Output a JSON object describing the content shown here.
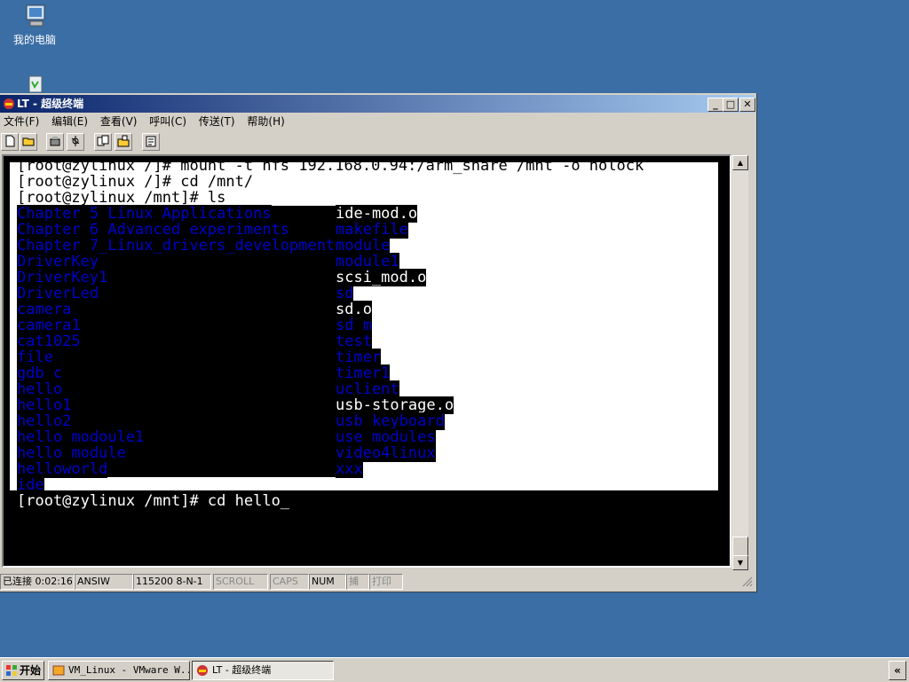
{
  "desktop": {
    "my_computer_label": "我的电脑"
  },
  "window": {
    "title": "LT - 超级终端",
    "menu": [
      "文件(F)",
      "编辑(E)",
      "查看(V)",
      "呼叫(C)",
      "传送(T)",
      "帮助(H)"
    ],
    "buttons": {
      "minimize": "_",
      "maximize": "□",
      "close": "✕"
    }
  },
  "terminal": {
    "lines": [
      "[root@zylinux /]# mount -t nfs 192.168.0.94:/arm_share /mnt -o nolock",
      "[root@zylinux /]# cd /mnt/",
      "[root@zylinux /mnt]# ls"
    ],
    "files_col1": [
      "Chapter_5_Linux_Applications",
      "Chapter_6_Advanced_experiments",
      "Chapter_7_Linux_drivers_development",
      "DriverKey",
      "DriverKey1",
      "DriverLed",
      "camera",
      "camera1",
      "cat1025",
      "file",
      "gdb_c",
      "hello",
      "hello1",
      "hello2",
      "hello_modoule1",
      "hello_module",
      "helloworld",
      "ide"
    ],
    "files_col2": [
      "ide-mod.o",
      "makefile",
      "module",
      "module1",
      "scsi_mod.o",
      "sd",
      "sd.o",
      "sd_m",
      "test",
      "timer",
      "timer1",
      "uclient",
      "usb-storage.o",
      "usb_keyboard",
      "use_modules",
      "video4linux",
      "xxx"
    ],
    "prompt": "[root@zylinux /mnt]# cd hello_"
  },
  "status": {
    "connected": "已连接 0:02:16",
    "emulation": "ANSIW",
    "port": "115200 8-N-1",
    "scroll": "SCROLL",
    "caps": "CAPS",
    "num": "NUM",
    "capture": "捕",
    "print": "打印"
  },
  "taskbar": {
    "start": "开始",
    "task1": "VM_Linux - VMware W...",
    "task2": "LT - 超级终端",
    "tray": "«"
  },
  "colors": {
    "desktop": "#3a6ea5",
    "titlebar": "#0a246a",
    "dir_text": "#0000cc"
  }
}
